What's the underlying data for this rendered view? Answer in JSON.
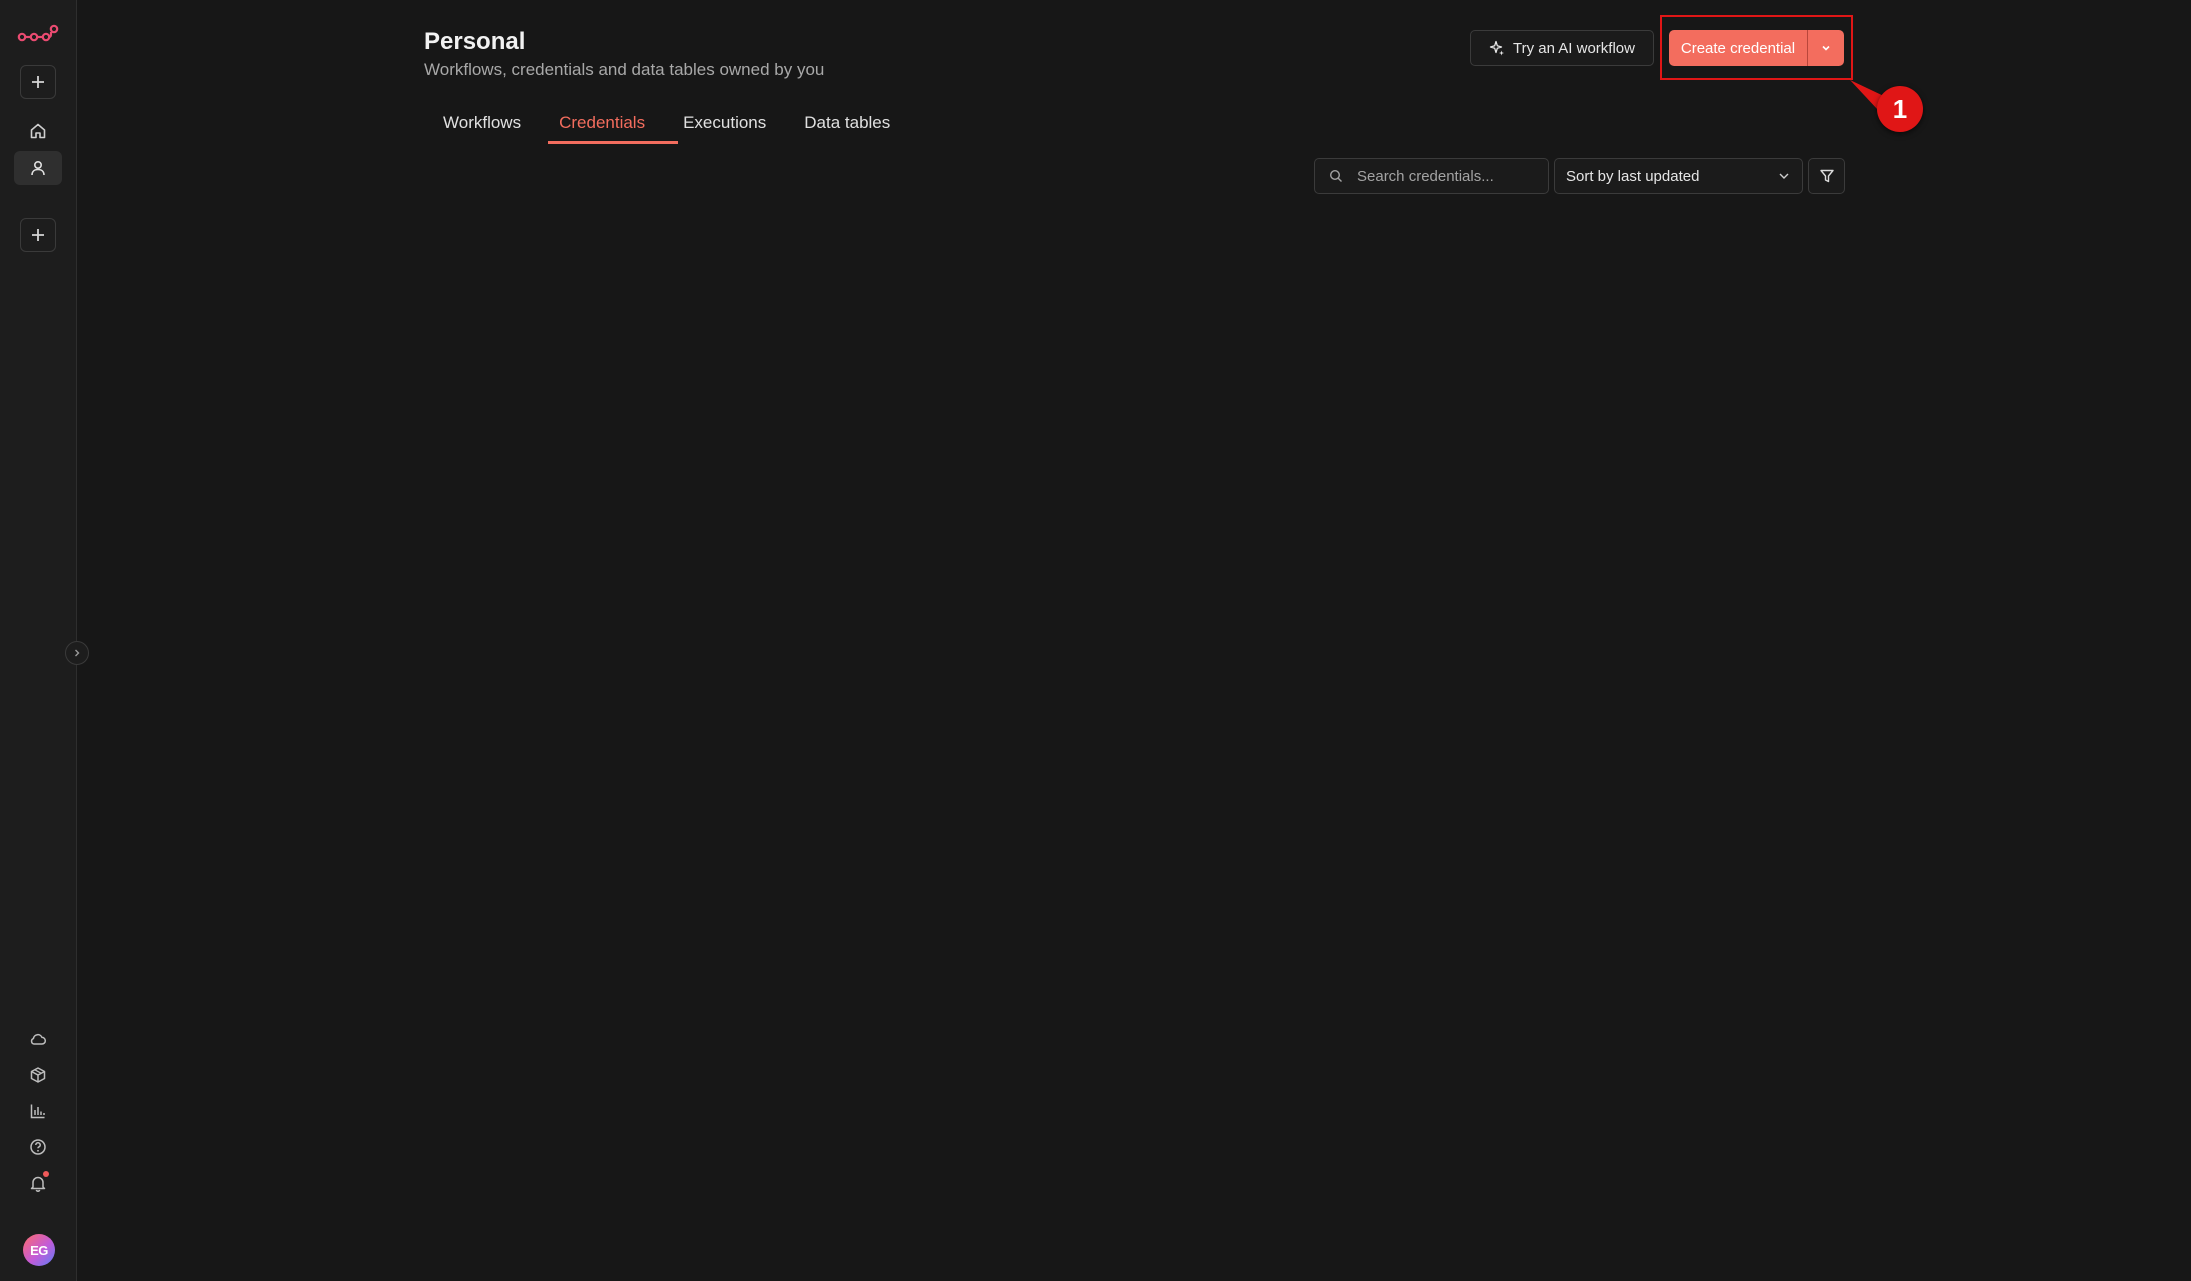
{
  "sidebar": {
    "logo_icon": "n8n-logo-icon",
    "avatar_initials": "EG",
    "colors": {
      "accent": "#ea4b71",
      "notification_dot": "#ef5a5a"
    }
  },
  "header": {
    "title": "Personal",
    "subtitle": "Workflows, credentials and data tables owned by you",
    "ai_button_label": "Try an AI workflow",
    "create_button_label": "Create credential"
  },
  "tabs": [
    {
      "label": "Workflows",
      "active": false
    },
    {
      "label": "Credentials",
      "active": true
    },
    {
      "label": "Executions",
      "active": false
    },
    {
      "label": "Data tables",
      "active": false
    }
  ],
  "toolbar": {
    "search_placeholder": "Search credentials...",
    "sort_selected": "Sort by last updated"
  },
  "annotation": {
    "label": "1",
    "color": "#e01616"
  },
  "colors": {
    "primary": "#f36d5e",
    "background": "#171717",
    "sidebar_background": "#1d1d1d"
  }
}
